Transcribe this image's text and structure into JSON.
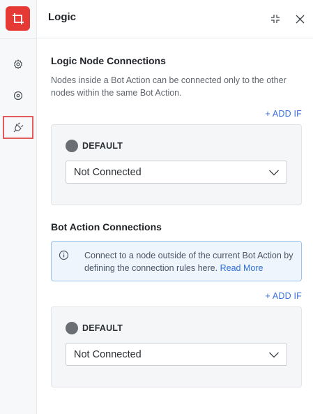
{
  "header": {
    "title": "Logic"
  },
  "sidebar": {
    "items": [
      {
        "name": "settings",
        "icon": "gear-icon"
      },
      {
        "name": "target",
        "icon": "target-icon"
      },
      {
        "name": "logic",
        "icon": "plug-icon",
        "active": true
      }
    ]
  },
  "logic_node": {
    "title": "Logic Node Connections",
    "description": "Nodes inside a Bot Action can be connected only to the other nodes within the same Bot Action.",
    "add_if_label": "+ ADD IF",
    "default_label": "DEFAULT",
    "select_value": "Not Connected"
  },
  "bot_action": {
    "title": "Bot Action Connections",
    "info_text": "Connect to a node outside of the current Bot Action by defining the connection rules here.",
    "info_link": "Read More",
    "add_if_label": "+ ADD IF",
    "default_label": "DEFAULT",
    "select_value": "Not Connected"
  },
  "colors": {
    "brand": "#e53935",
    "accent": "#3b6fd8",
    "active_outline": "#e25a5a",
    "info_border": "#9cc3ee"
  }
}
